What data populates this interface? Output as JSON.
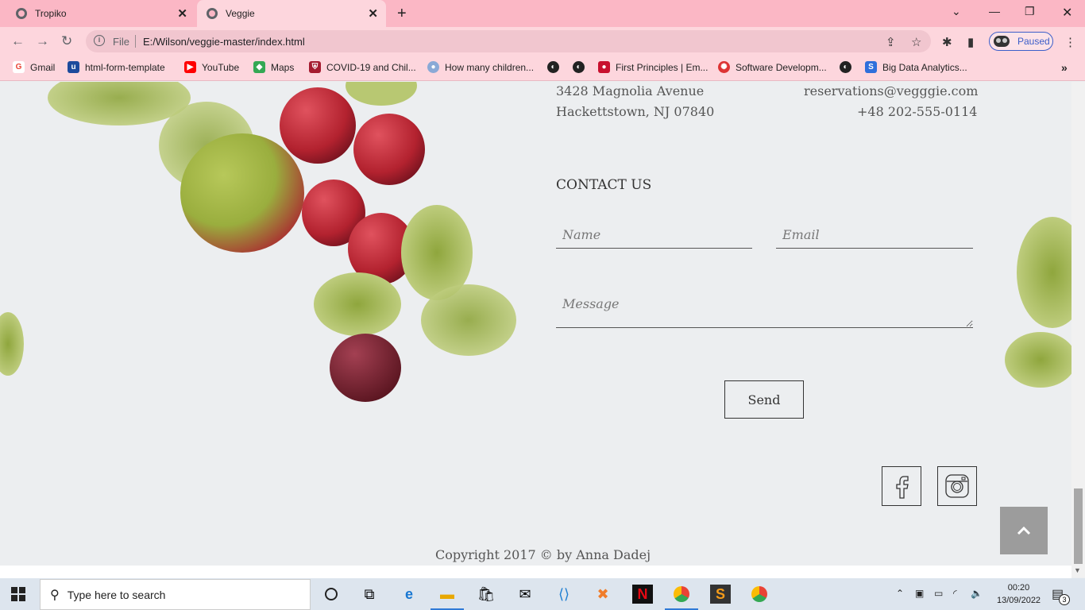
{
  "browser": {
    "tabs": [
      {
        "title": "Tropiko"
      },
      {
        "title": "Veggie"
      }
    ],
    "address": {
      "scheme_label": "File",
      "url": "E:/Wilson/veggie-master/index.html"
    },
    "profile_label": "Paused",
    "bookmarks": [
      {
        "label": "Gmail",
        "color": "#ea4335"
      },
      {
        "label": "html-form-template",
        "color": "#1d4a9c"
      },
      {
        "label": "YouTube",
        "color": "#ff0000"
      },
      {
        "label": "Maps",
        "color": "#34a853"
      },
      {
        "label": "COVID-19 and Chil...",
        "color": "#a51c30"
      },
      {
        "label": "How many children...",
        "color": "#8aa9d6"
      },
      {
        "label": "First Principles | Em...",
        "color": "#c8102e"
      },
      {
        "label": "Software Developm...",
        "color": "#d33"
      },
      {
        "label": "Big Data Analytics...",
        "color": "#2f6fdb"
      }
    ]
  },
  "page": {
    "address_line1": "3428 Magnolia Avenue",
    "address_line2": "Hackettstown, NJ 07840",
    "email": "reservations@vegggie.com",
    "phone": "+48 202-555-0114",
    "contact_title": "CONTACT US",
    "form": {
      "name_placeholder": "Name",
      "email_placeholder": "Email",
      "message_placeholder": "Message",
      "send_label": "Send"
    },
    "copyright": "Copyright 2017 © by Anna Dadej"
  },
  "taskbar": {
    "search_placeholder": "Type here to search",
    "time": "00:20",
    "date": "13/09/2022",
    "notification_count": "3"
  }
}
